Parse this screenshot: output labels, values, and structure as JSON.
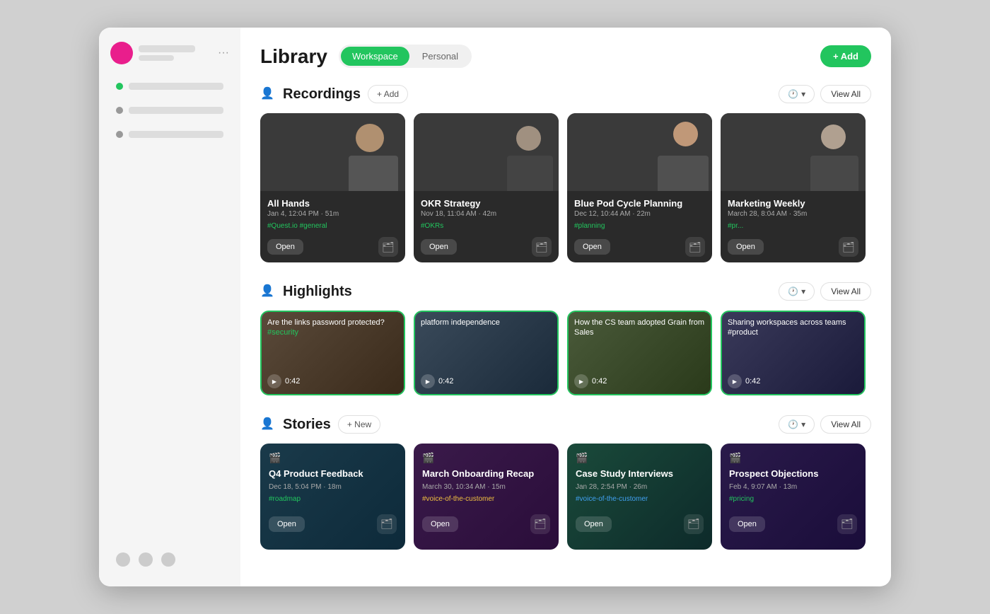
{
  "app": {
    "title": "Library"
  },
  "header": {
    "title": "Library",
    "tabs": [
      {
        "label": "Workspace",
        "active": true
      },
      {
        "label": "Personal",
        "active": false
      }
    ],
    "add_button": "+ Add"
  },
  "sidebar": {
    "items": [
      {
        "label": "Blurred item 1",
        "color": "#22c55e"
      },
      {
        "label": "Blurred item 2",
        "color": "#999"
      },
      {
        "label": "Blurred item 3",
        "color": "#999"
      }
    ]
  },
  "sections": {
    "recordings": {
      "title": "Recordings",
      "add_label": "+ Add",
      "sort_label": "🕐",
      "view_all": "View All",
      "cards": [
        {
          "title": "All Hands",
          "date": "Jan 4, 12:04 PM · 51m",
          "tag": "#Quest.io #general",
          "open_label": "Open"
        },
        {
          "title": "OKR Strategy",
          "date": "Nov 18, 11:04 AM · 42m",
          "tag": "#OKRs",
          "open_label": "Open"
        },
        {
          "title": "Blue Pod Cycle Planning",
          "date": "Dec 12, 10:44 AM · 22m",
          "tag": "#planning",
          "open_label": "Open"
        },
        {
          "title": "Marketing Weekly",
          "date": "March 28, 8:04 AM · 35m",
          "tag": "#pr...",
          "open_label": "Open"
        }
      ]
    },
    "highlights": {
      "title": "Highlights",
      "sort_label": "🕐",
      "view_all": "View All",
      "cards": [
        {
          "label": "Are the links password protected? #security",
          "duration": "0:42",
          "green_border": true
        },
        {
          "label": "platform independence",
          "duration": "0:42",
          "green_border": true
        },
        {
          "label": "How the CS team adopted Grain from Sales",
          "duration": "0:42",
          "green_border": true
        },
        {
          "label": "Sharing workspaces across teams #product",
          "duration": "0:42",
          "green_border": true
        }
      ]
    },
    "stories": {
      "title": "Stories",
      "new_label": "+ New",
      "sort_label": "🕐",
      "view_all": "View All",
      "cards": [
        {
          "title": "Q4 Product Feedback",
          "date": "Dec 18, 5:04 PM · 18m",
          "tag": "#roadmap",
          "open_label": "Open",
          "style": "1"
        },
        {
          "title": "March Onboarding Recap",
          "date": "March 30, 10:34 AM · 15m",
          "tag": "#voice-of-the-customer",
          "open_label": "Open",
          "style": "2"
        },
        {
          "title": "Case Study Interviews",
          "date": "Jan 28, 2:54 PM · 26m",
          "tag": "#voice-of-the-customer",
          "open_label": "Open",
          "style": "3"
        },
        {
          "title": "Prospect Objections",
          "date": "Feb 4, 9:07 AM · 13m",
          "tag": "#pricing",
          "open_label": "Open",
          "style": "4"
        }
      ]
    }
  }
}
